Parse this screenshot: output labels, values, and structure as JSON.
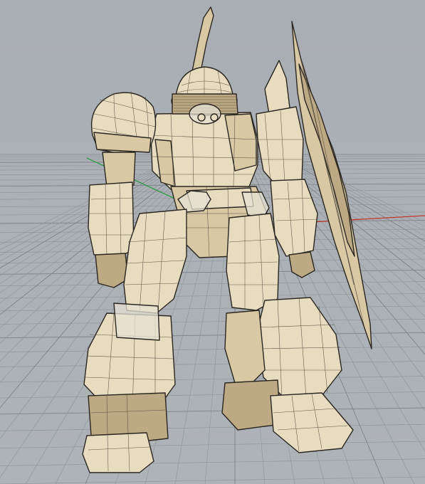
{
  "viewport": {
    "background_top": "#a9aeb4",
    "background_bottom": "#aeb3b8",
    "grid_color": "#8e9398",
    "grid_major_color": "#7d8288",
    "x_axis_color": "#c0392b",
    "y_axis_color": "#2e9b45",
    "model_fill": "#e3d5b3",
    "model_edge": "#2a2620"
  }
}
